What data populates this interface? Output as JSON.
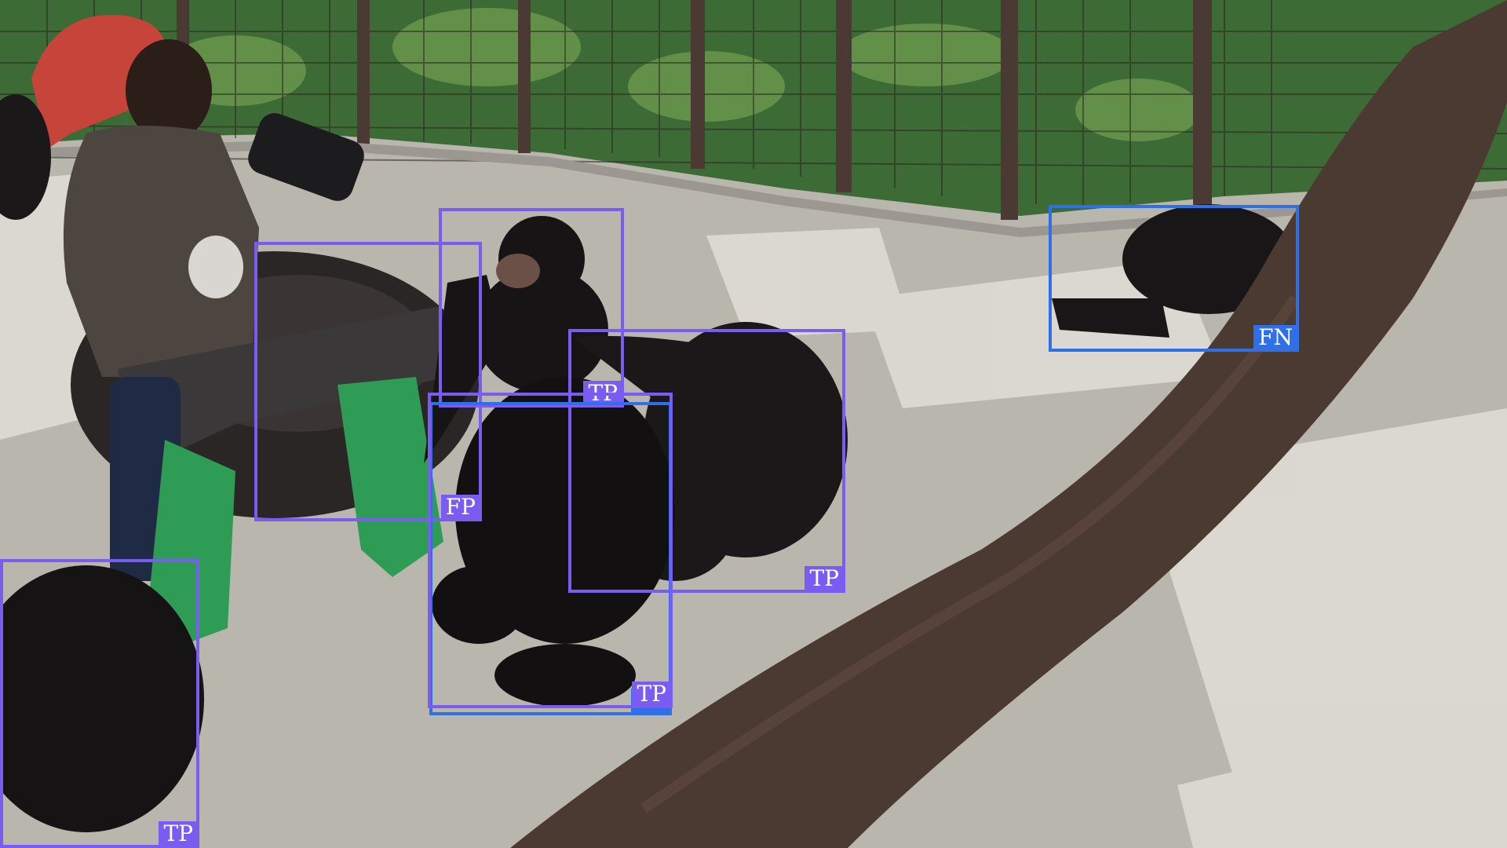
{
  "colors": {
    "detection_box": "#7a5cf0",
    "ground_truth_box": "#2f6fe8",
    "floor": "#b9b6ae",
    "foliage": "#3d6b35",
    "fence": "#4a3a33",
    "trunk": "#4b3a31"
  },
  "annotations": {
    "box_woman": {
      "label": "FP"
    },
    "box_chimp_sitting": {
      "label": "TP"
    },
    "box_chimp_lying": {
      "label": "TP"
    },
    "box_chimp_standing": {
      "label": "TP"
    },
    "box_chimp_standing_gt": {
      "label": "TP"
    },
    "box_chimp_right": {
      "label": "FN"
    },
    "box_chimp_bottom_left": {
      "label": "TP"
    }
  }
}
